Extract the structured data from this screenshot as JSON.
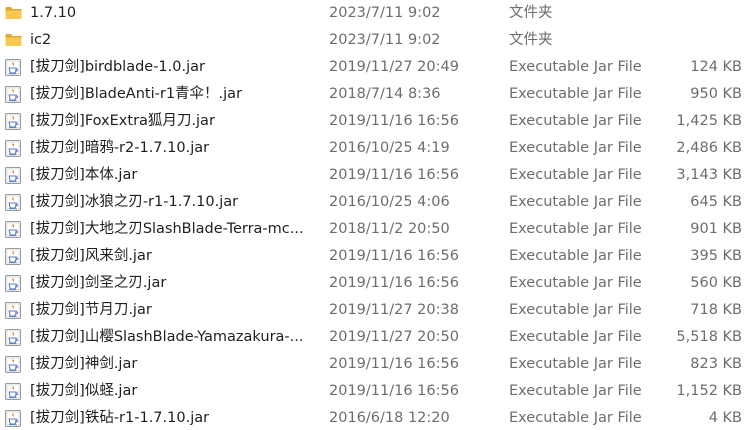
{
  "colors": {
    "folder": "#f8c852",
    "folder_dark": "#e0a82e",
    "jar_doc": "#f4f4f4",
    "jar_cup": "#5b7fc0",
    "jar_flame": "#e87722"
  },
  "files": [
    {
      "icon": "folder-icon",
      "name": "1.7.10",
      "date": "2023/7/11 9:02",
      "type": "文件夹",
      "size": ""
    },
    {
      "icon": "folder-icon",
      "name": "ic2",
      "date": "2023/7/11 9:02",
      "type": "文件夹",
      "size": ""
    },
    {
      "icon": "java-jar-icon",
      "name": "[拔刀剑]birdblade-1.0.jar",
      "date": "2019/11/27 20:49",
      "type": "Executable Jar File",
      "size": "124 KB"
    },
    {
      "icon": "java-jar-icon",
      "name": "[拔刀剑]BladeAnti-r1青伞！.jar",
      "date": "2018/7/14 8:36",
      "type": "Executable Jar File",
      "size": "950 KB"
    },
    {
      "icon": "java-jar-icon",
      "name": "[拔刀剑]FoxExtra狐月刀.jar",
      "date": "2019/11/16 16:56",
      "type": "Executable Jar File",
      "size": "1,425 KB"
    },
    {
      "icon": "java-jar-icon",
      "name": "[拔刀剑]暗鸦-r2-1.7.10.jar",
      "date": "2016/10/25 4:19",
      "type": "Executable Jar File",
      "size": "2,486 KB"
    },
    {
      "icon": "java-jar-icon",
      "name": "[拔刀剑]本体.jar",
      "date": "2019/11/16 16:56",
      "type": "Executable Jar File",
      "size": "3,143 KB"
    },
    {
      "icon": "java-jar-icon",
      "name": "[拔刀剑]冰狼之刃-r1-1.7.10.jar",
      "date": "2016/10/25 4:06",
      "type": "Executable Jar File",
      "size": "645 KB"
    },
    {
      "icon": "java-jar-icon",
      "name": "[拔刀剑]大地之刃SlashBlade-Terra-mc...",
      "date": "2018/11/2 20:50",
      "type": "Executable Jar File",
      "size": "901 KB"
    },
    {
      "icon": "java-jar-icon",
      "name": "[拔刀剑]风来剑.jar",
      "date": "2019/11/16 16:56",
      "type": "Executable Jar File",
      "size": "395 KB"
    },
    {
      "icon": "java-jar-icon",
      "name": "[拔刀剑]剑圣之刃.jar",
      "date": "2019/11/16 16:56",
      "type": "Executable Jar File",
      "size": "560 KB"
    },
    {
      "icon": "java-jar-icon",
      "name": "[拔刀剑]节月刀.jar",
      "date": "2019/11/27 20:38",
      "type": "Executable Jar File",
      "size": "718 KB"
    },
    {
      "icon": "java-jar-icon",
      "name": "[拔刀剑]山樱SlashBlade-Yamazakura-...",
      "date": "2019/11/27 20:50",
      "type": "Executable Jar File",
      "size": "5,518 KB"
    },
    {
      "icon": "java-jar-icon",
      "name": "[拔刀剑]神剑.jar",
      "date": "2019/11/16 16:56",
      "type": "Executable Jar File",
      "size": "823 KB"
    },
    {
      "icon": "java-jar-icon",
      "name": "[拔刀剑]似蛏.jar",
      "date": "2019/11/16 16:56",
      "type": "Executable Jar File",
      "size": "1,152 KB"
    },
    {
      "icon": "java-jar-icon",
      "name": "[拔刀剑]铁砧-r1-1.7.10.jar",
      "date": "2016/6/18 12:20",
      "type": "Executable Jar File",
      "size": "4 KB"
    }
  ]
}
